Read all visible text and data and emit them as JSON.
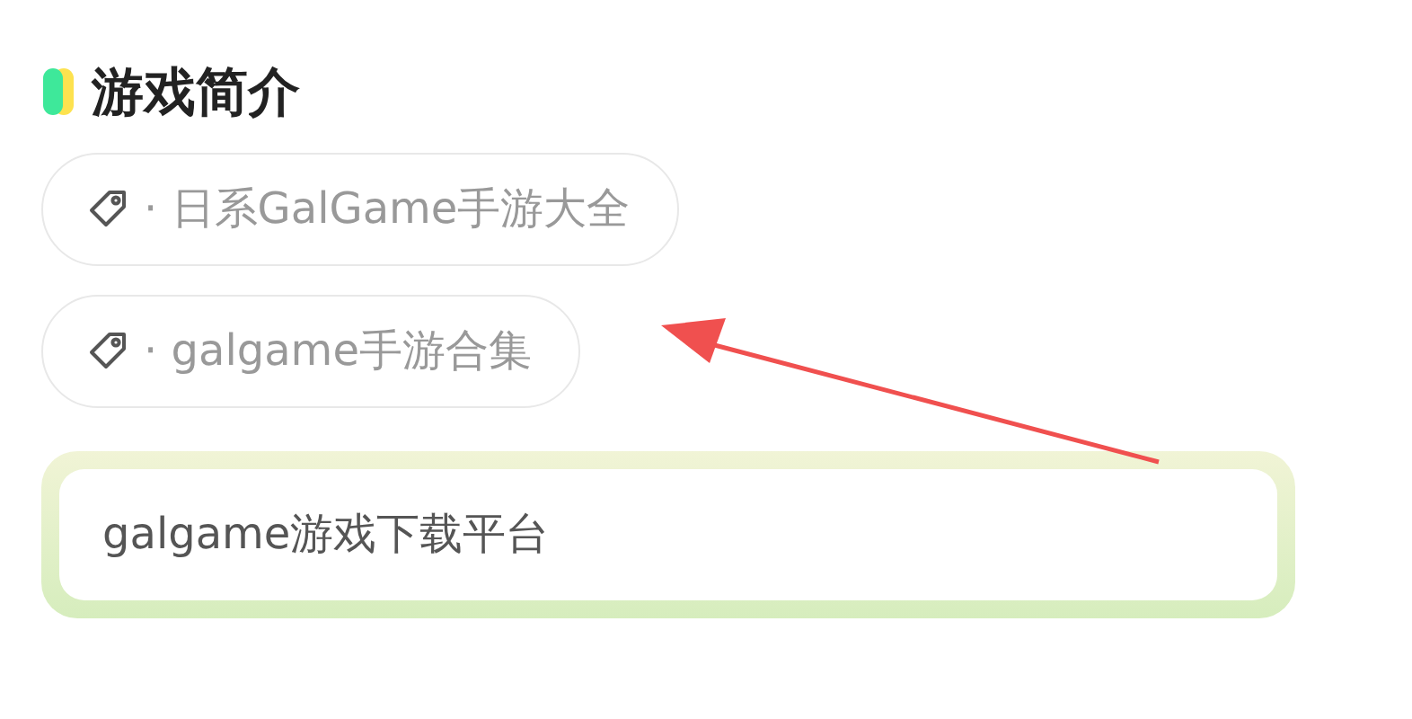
{
  "section": {
    "title": "游戏简介"
  },
  "tags": [
    {
      "label": "· 日系GalGame手游大全"
    },
    {
      "label": "· galgame手游合集"
    }
  ],
  "intro": {
    "text": "galgame游戏下载平台"
  },
  "annotation": {
    "kind": "arrow"
  }
}
